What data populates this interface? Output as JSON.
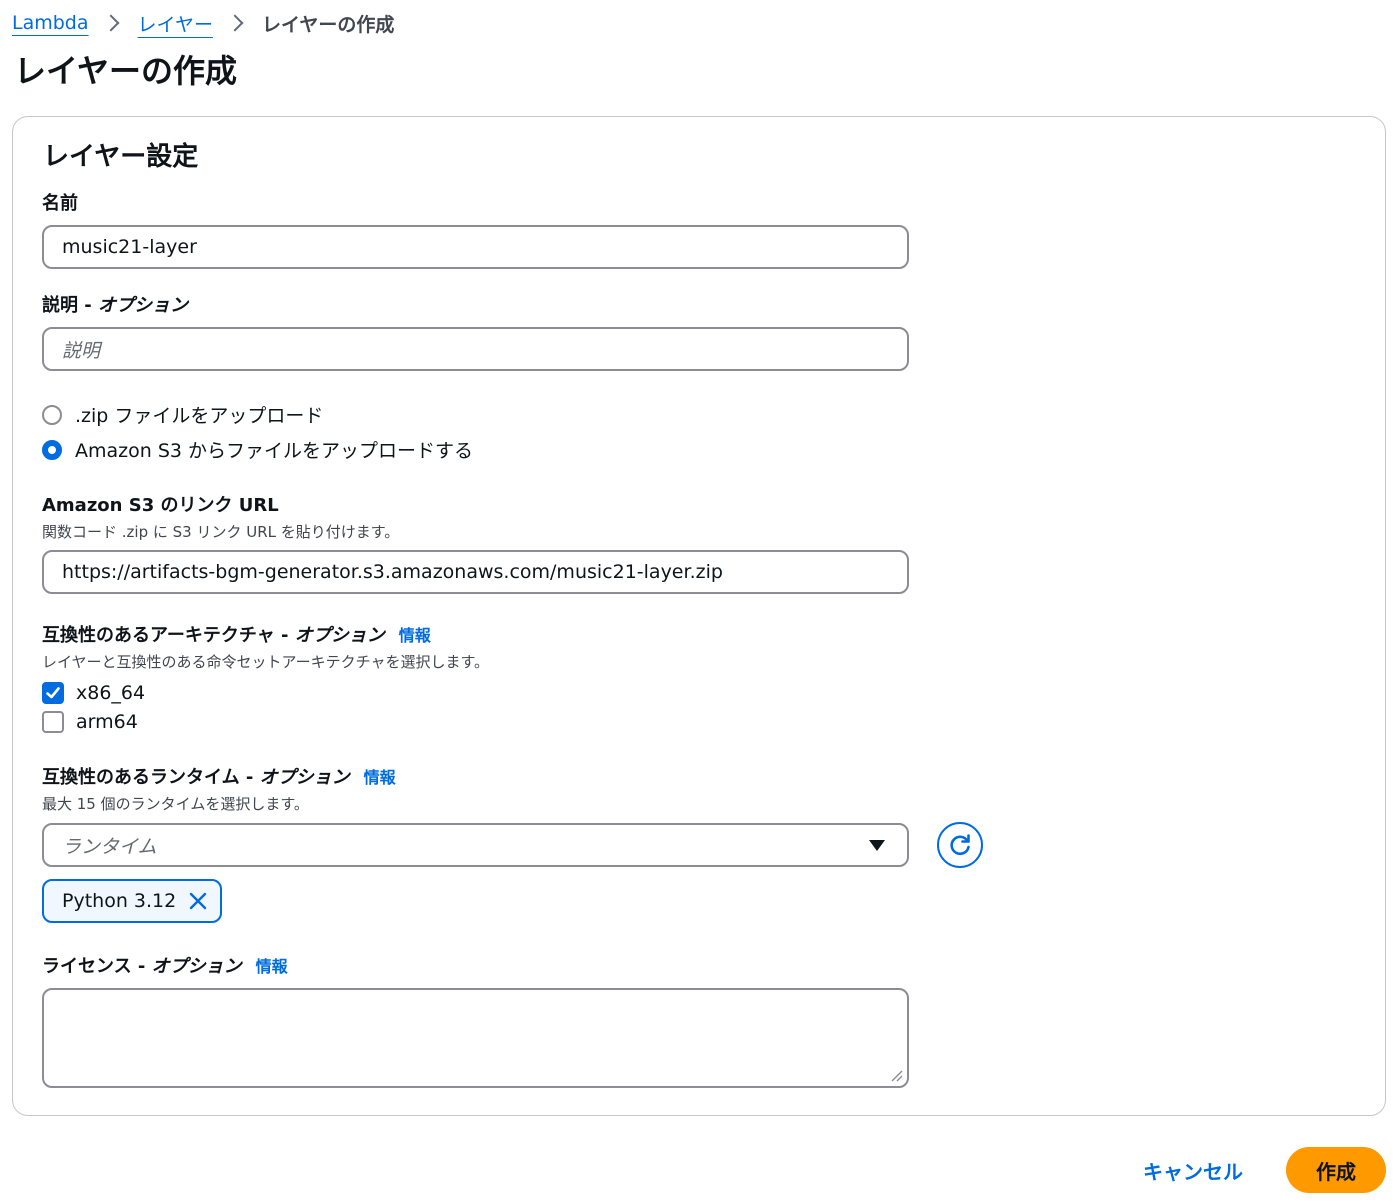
{
  "breadcrumb": [
    "Lambda",
    "レイヤー",
    "レイヤーの作成"
  ],
  "page_title": "レイヤーの作成",
  "panel": {
    "title": "レイヤー設定",
    "name": {
      "label": "名前",
      "value": "music21-layer"
    },
    "description": {
      "label": "説明 - ",
      "optional": "オプション",
      "placeholder": "説明"
    },
    "upload": {
      "options": [
        ".zip ファイルをアップロード",
        "Amazon S3 からファイルをアップロードする"
      ],
      "selected": 1
    },
    "s3": {
      "label": "Amazon S3 のリンク URL",
      "desc": "関数コード .zip に S3 リンク URL を貼り付けます。",
      "value": "https://artifacts-bgm-generator.s3.amazonaws.com/music21-layer.zip"
    },
    "arch": {
      "label": "互換性のあるアーキテクチャ - ",
      "optional": "オプション",
      "info": "情報",
      "desc": "レイヤーと互換性のある命令セットアーキテクチャを選択します。",
      "options": [
        {
          "label": "x86_64",
          "checked": true
        },
        {
          "label": "arm64",
          "checked": false
        }
      ]
    },
    "runtime": {
      "label": "互換性のあるランタイム - ",
      "optional": "オプション",
      "info": "情報",
      "desc": "最大 15 個のランタイムを選択します。",
      "placeholder": "ランタイム",
      "selected_token": "Python 3.12"
    },
    "license": {
      "label": "ライセンス - ",
      "optional": "オプション",
      "info": "情報",
      "value": ""
    }
  },
  "actions": {
    "cancel": "キャンセル",
    "create": "作成"
  },
  "colors": {
    "link": "#006ce0",
    "primary_button": "#ff9900"
  }
}
